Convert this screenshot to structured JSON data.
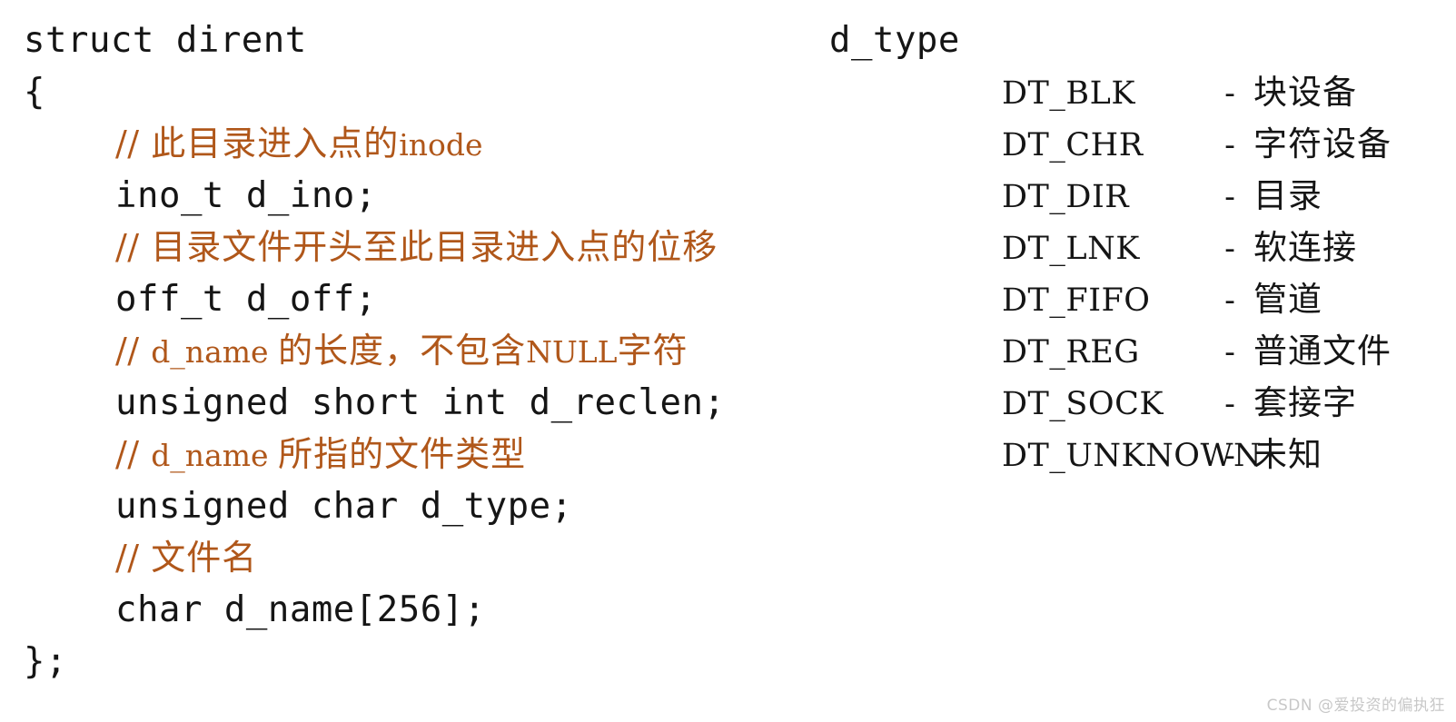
{
  "colors": {
    "background": "#ffffff",
    "code_text": "#151515",
    "comment_text": "#b0571a",
    "watermark_text": "#c8c8c8"
  },
  "struct_block": {
    "lines": [
      {
        "kind": "code",
        "indent": false,
        "text": "struct dirent"
      },
      {
        "kind": "code",
        "indent": false,
        "text": "{"
      },
      {
        "kind": "comment",
        "indent": true,
        "slashes": "// ",
        "cjk1": "此目录进入点的",
        "lat1": "inode",
        "cjk2": "",
        "lat2": "",
        "cjk3": "",
        "text": "// 此目录进入点的inode"
      },
      {
        "kind": "code",
        "indent": true,
        "text": "ino_t d_ino;"
      },
      {
        "kind": "comment",
        "indent": true,
        "slashes": "// ",
        "cjk1": "目录文件开头至此目录进入点的位移",
        "lat1": "",
        "cjk2": "",
        "lat2": "",
        "cjk3": "",
        "text": "// 目录文件开头至此目录进入点的位移"
      },
      {
        "kind": "code",
        "indent": true,
        "text": "off_t d_off;"
      },
      {
        "kind": "comment",
        "indent": true,
        "slashes": "// ",
        "cjk1": "",
        "lat1": "d_name ",
        "cjk2": "的长度，不包含",
        "lat2": "NULL",
        "cjk3": "字符",
        "text": "// d_name 的长度，不包含NULL字符"
      },
      {
        "kind": "code",
        "indent": true,
        "text": "unsigned short int d_reclen;"
      },
      {
        "kind": "comment",
        "indent": true,
        "slashes": "// ",
        "cjk1": "",
        "lat1": "d_name ",
        "cjk2": "所指的文件类型",
        "lat2": "",
        "cjk3": "",
        "text": "// d_name 所指的文件类型"
      },
      {
        "kind": "code",
        "indent": true,
        "text": "unsigned char d_type;"
      },
      {
        "kind": "comment",
        "indent": true,
        "slashes": "// ",
        "cjk1": "文件名",
        "lat1": "",
        "cjk2": "",
        "lat2": "",
        "cjk3": "",
        "text": "// 文件名"
      },
      {
        "kind": "code",
        "indent": true,
        "text": "char d_name[256];"
      },
      {
        "kind": "code",
        "indent": false,
        "text": "};"
      }
    ]
  },
  "dtype_block": {
    "title": "d_type",
    "rows": [
      {
        "name": "DT_BLK",
        "dash": "-",
        "desc": "块设备"
      },
      {
        "name": "DT_CHR",
        "dash": "-",
        "desc": "字符设备"
      },
      {
        "name": "DT_DIR",
        "dash": "-",
        "desc": "目录"
      },
      {
        "name": "DT_LNK",
        "dash": "-",
        "desc": "软连接"
      },
      {
        "name": "DT_FIFO",
        "dash": "-",
        "desc": "管道"
      },
      {
        "name": "DT_REG",
        "dash": "-",
        "desc": "普通文件"
      },
      {
        "name": "DT_SOCK",
        "dash": "-",
        "desc": "套接字"
      },
      {
        "name": "DT_UNKNOWN",
        "dash": "-",
        "desc": "未知"
      }
    ]
  },
  "watermark": {
    "text": "CSDN @爱投资的偏执狂"
  }
}
